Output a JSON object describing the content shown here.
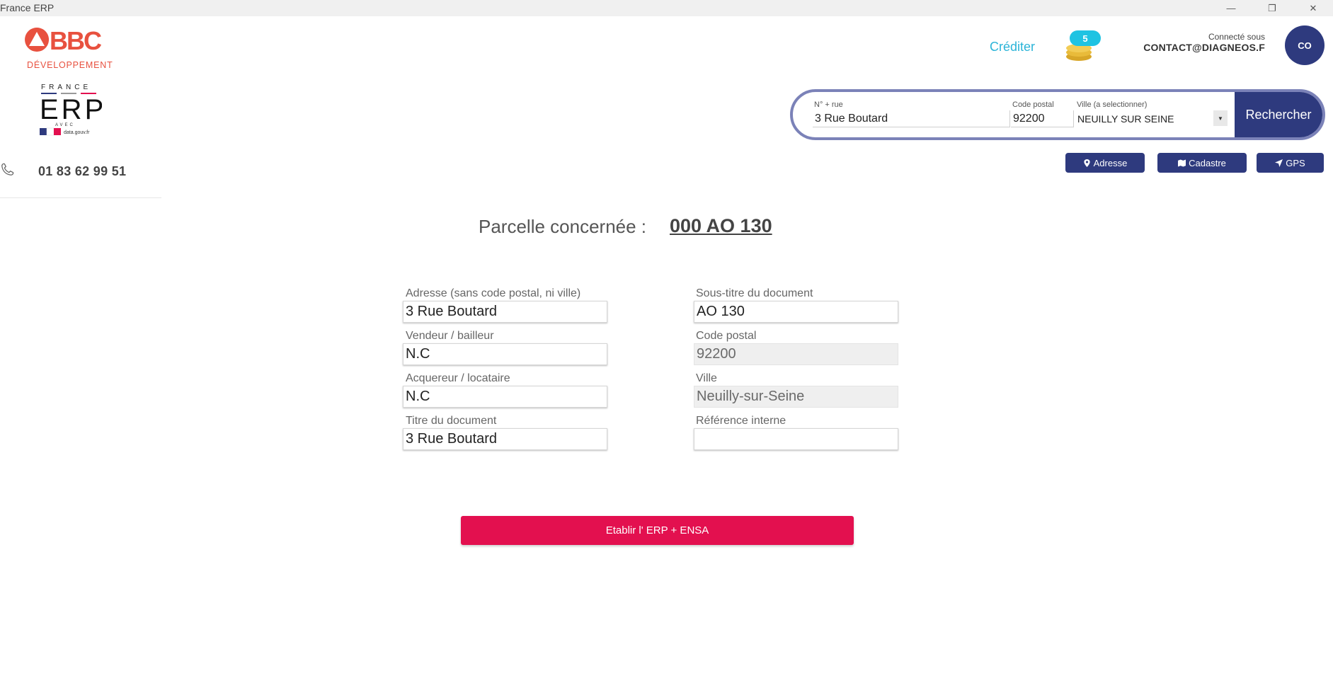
{
  "window": {
    "title": "France ERP",
    "controls": {
      "minimize": "—",
      "restore": "❐",
      "close": "✕"
    }
  },
  "sidebar": {
    "logo_bbc": {
      "brand": "BBC",
      "subtitle": "DÉVELOPPEMENT",
      "color": "#e8513f"
    },
    "logo_erp": {
      "top": "FRANCE",
      "main": "ERP",
      "avec": "AVEC",
      "partner": "data.gouv.fr"
    },
    "phone": "01 83 62 99 51",
    "phone_icon": "phone-icon"
  },
  "header": {
    "credit_link": "Créditer",
    "credit_count": "5",
    "connected_label": "Connecté sous",
    "connected_email": "CONTACT@DIAGNEOS.F",
    "avatar_initials": "CO"
  },
  "search": {
    "street_label": "N° + rue",
    "street_value": "3  Rue Boutard",
    "postal_label": "Code postal",
    "postal_value": "92200",
    "city_label": "Ville (a selectionner)",
    "city_value": "NEUILLY SUR SEINE",
    "button": "Rechercher"
  },
  "modes": {
    "adresse": "Adresse",
    "cadastre": "Cadastre",
    "gps": "GPS"
  },
  "parcelle": {
    "label": "Parcelle concernée :",
    "value": "000 AO 130"
  },
  "form": {
    "adresse_label": "Adresse (sans code postal, ni ville)",
    "adresse_value": "3 Rue Boutard",
    "vendeur_label": "Vendeur / bailleur",
    "vendeur_value": "N.C",
    "acquereur_label": "Acquereur / locataire",
    "acquereur_value": "N.C",
    "titre_label": "Titre du document",
    "titre_value": "3 Rue Boutard",
    "soustitre_label": "Sous-titre du document",
    "soustitre_value": "AO 130",
    "cp_label": "Code postal",
    "cp_value": "92200",
    "ville_label": "Ville",
    "ville_value": "Neuilly-sur-Seine",
    "ref_label": "Référence interne",
    "ref_value": ""
  },
  "submit_button": "Etablir l' ERP + ENSA",
  "colors": {
    "primary": "#2e3a7e",
    "accent": "#e3104f",
    "link": "#2bb4d8",
    "badge": "#1fc3e2"
  }
}
